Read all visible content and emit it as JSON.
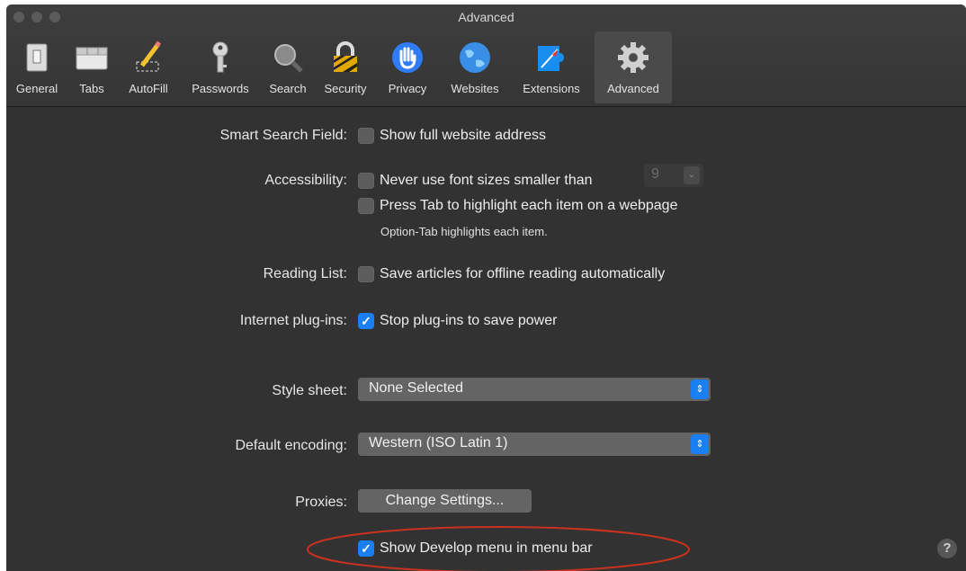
{
  "window": {
    "title": "Advanced"
  },
  "toolbar": {
    "tabs": [
      {
        "label": "General",
        "icon": "general-switch-icon"
      },
      {
        "label": "Tabs",
        "icon": "tabs-icon"
      },
      {
        "label": "AutoFill",
        "icon": "pencil-icon"
      },
      {
        "label": "Passwords",
        "icon": "key-icon"
      },
      {
        "label": "Search",
        "icon": "magnifier-icon"
      },
      {
        "label": "Security",
        "icon": "lock-icon"
      },
      {
        "label": "Privacy",
        "icon": "hand-icon"
      },
      {
        "label": "Websites",
        "icon": "globe-icon"
      },
      {
        "label": "Extensions",
        "icon": "puzzle-compass-icon"
      },
      {
        "label": "Advanced",
        "icon": "gear-icon",
        "selected": true
      }
    ]
  },
  "settings": {
    "smart_search": {
      "label": "Smart Search Field:",
      "option": "Show full website address",
      "checked": false
    },
    "accessibility": {
      "label": "Accessibility:",
      "font_option": "Never use font sizes smaller than",
      "font_size_value": "9",
      "font_option_checked": false,
      "tab_option": "Press Tab to highlight each item on a webpage",
      "tab_option_checked": false,
      "note": "Option-Tab highlights each item."
    },
    "reading_list": {
      "label": "Reading List:",
      "option": "Save articles for offline reading automatically",
      "checked": false
    },
    "plugins": {
      "label": "Internet plug-ins:",
      "option": "Stop plug-ins to save power",
      "checked": true
    },
    "style_sheet": {
      "label": "Style sheet:",
      "value": "None Selected"
    },
    "encoding": {
      "label": "Default encoding:",
      "value": "Western (ISO Latin 1)"
    },
    "proxies": {
      "label": "Proxies:",
      "button": "Change Settings..."
    },
    "develop_menu": {
      "option": "Show Develop menu in menu bar",
      "checked": true
    }
  },
  "help": {
    "label": "?"
  },
  "colors": {
    "accent": "#1a7ff2",
    "highlight_ellipse": "#c8321e",
    "window_bg": "#323232"
  }
}
